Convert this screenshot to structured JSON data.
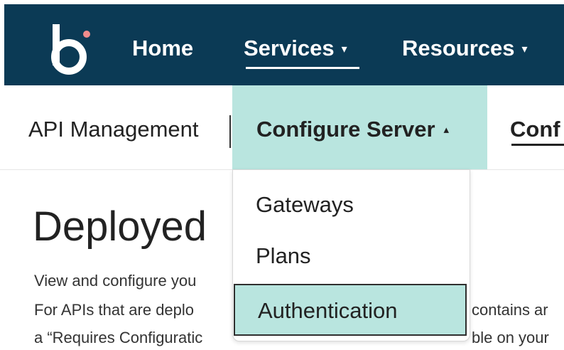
{
  "topnav": {
    "home": "Home",
    "services": "Services",
    "resources": "Resources",
    "caret_down": "▾"
  },
  "subnav": {
    "api_management": "API Management",
    "configure_server": "Configure Server",
    "caret_up": "▴",
    "next_partial": "Conf"
  },
  "dropdown": {
    "items": [
      "Gateways",
      "Plans",
      "Authentication"
    ]
  },
  "main": {
    "heading_visible": "Deployed",
    "line1_visible": "View and configure you",
    "line2_left": "For APIs that are deplo",
    "line2_right": "contains ar",
    "line3_left": "a “Requires Configuratic",
    "line3_right": "ble on your"
  },
  "colors": {
    "topbar": "#0b3a55",
    "accent": "#b9e5df",
    "logo_dot": "#f08c8c"
  },
  "icons": {
    "logo": "b-logo-icon"
  }
}
